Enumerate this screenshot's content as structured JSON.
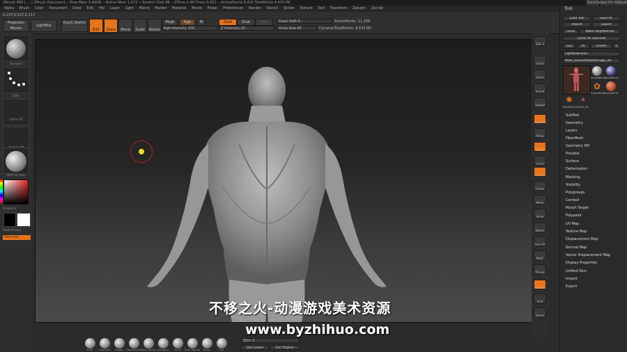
{
  "window": {
    "title": "ZBrush 4R6 [ ... ]   ZBrush Document   ---Free Mem 3.44GB   ---Active Mem 1.072   ---Scratch Disk 48   ---ZTime 1.49   Timer 0.001   ---ActivePoints 9.415   TotalPoints 4.433 Mil",
    "buttons": [
      "QuickSave",
      "See-through",
      "DefaultZScript"
    ]
  },
  "menu": [
    "Alpha",
    "Brush",
    "Color",
    "Document",
    "Draw",
    "Edit",
    "File",
    "Layer",
    "Light",
    "Macro",
    "Marker",
    "Material",
    "Movie",
    "Picker",
    "Preferences",
    "Render",
    "Stencil",
    "Stroke",
    "Texture",
    "Tool",
    "Transform",
    "Zplugin",
    "Zscript"
  ],
  "coordinates": "0.237,0.527,0.117",
  "topshelf": {
    "projection_master": "Projection Master",
    "lightbox": "LightBox",
    "quick_sketch": "Quick Sketch",
    "edit": "Edit",
    "draw": "Draw",
    "move": "Move",
    "scale": "Scale",
    "rotate": "Rotate",
    "mrgb": "Mrgb",
    "rgb": "Rgb",
    "m": "M",
    "rgb_intensity": "Rgb Intensity 100",
    "zadd": "Zadd",
    "zsub": "Zsub",
    "zcut": "Zcut",
    "z_intensity": "Z Intensity 25",
    "focal_shift": "Focal Shift 0",
    "draw_size": "Draw Size 85",
    "dynamic": "Dynamic",
    "active_points": "ActivePoints: 11,258",
    "total_points": "TotalPoints: 9.433 Mil"
  },
  "leftshelf": {
    "standard": "Standard",
    "dots": "Dots",
    "alpha_off": "Alpha Off",
    "texture_off": "Texture Off",
    "matcap": "MatCap Gray",
    "gradient": "Gradient",
    "switch_color": "SwitchColor",
    "alternate": "Alternate"
  },
  "rightshelf": [
    "SPix 3",
    "Scroll",
    "Zoom",
    "Actual",
    "AAHalf",
    "Dynamic",
    "Persp",
    "Floor",
    "Local",
    "Gxyz",
    "Frame",
    "Move",
    "Scale",
    "Rotate",
    "Line Fill",
    "PolyF",
    "Transp",
    "Ghost",
    "Solo",
    "Xpose"
  ],
  "tool": {
    "header": "Tool",
    "load_tool": "Load Tool",
    "save_as": "Save As",
    "import": "Import",
    "export": "Export",
    "clone": "Clone",
    "make_polymesh": "Make PolyMesh3D",
    "clone_all": "Clone All SubTools",
    "goz": "GoZ",
    "all": "All",
    "visible": "Visible",
    "r": "R",
    "lightbox_tools": "Lightbox▸Tools",
    "current_tool": "Male_HumanMaleAverage_48",
    "thumb_labels": [
      "SimpleBrush",
      "AlphaBrush",
      "EraserBrush",
      "Cylinder3D",
      "PolyMesh3D",
      "Male_He"
    ],
    "sections": [
      "SubTool",
      "Geometry",
      "Layers",
      "FiberMesh",
      "Geometry HD",
      "Preview",
      "Surface",
      "Deformation",
      "Masking",
      "Visibility",
      "Polygroups",
      "Contact",
      "Morph Target",
      "Polypaint",
      "UV Map",
      "Texture Map",
      "Displacement Map",
      "Normal Map",
      "Vector Displacement Map",
      "Display Properties",
      "Unified Skin",
      "Import",
      "Export"
    ]
  },
  "bottom": {
    "brushes": [
      "Inflat",
      "ClayTubes",
      "hPolish",
      "DamStandard",
      "Move Topological",
      "Standard",
      "Pinch",
      "Dam Standard",
      "Move",
      "Clay"
    ],
    "sdiv": "SDiv 3",
    "del_lower": "Del Lower",
    "del_higher": "Del Higher"
  },
  "watermark": {
    "line1": "不移之火-动漫游戏美术资源",
    "line2": "www.byzhihuo.com"
  },
  "colors": {
    "accent": "#e8731a",
    "background": "#2b2b2b",
    "viewport_top": "#1d1d1d"
  }
}
